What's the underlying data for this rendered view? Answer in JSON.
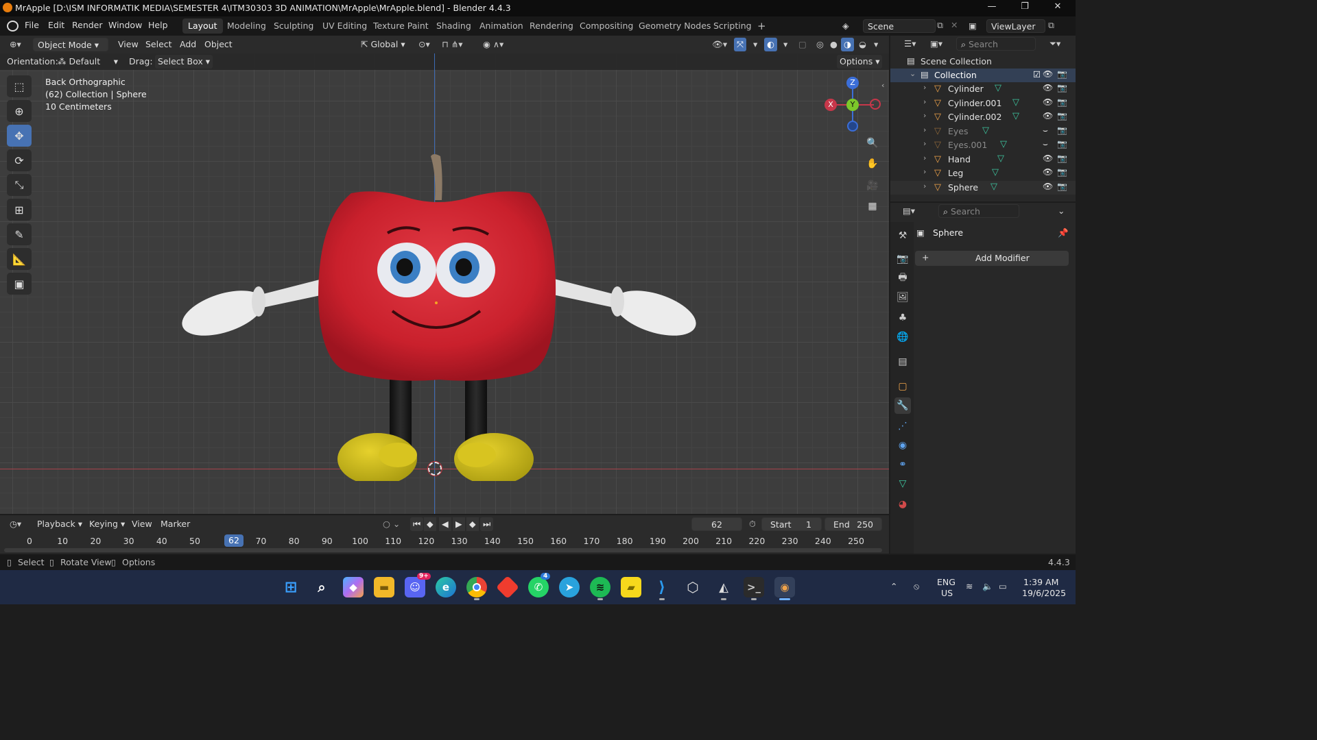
{
  "window": {
    "title": "MrApple [D:\\ISM INFORMATIK MEDIA\\SEMESTER 4\\ITM30303 3D ANIMATION\\MrApple\\MrApple.blend] - Blender 4.4.3",
    "minimize": "—",
    "maximize": "❐",
    "close": "✕"
  },
  "menu": {
    "file": "File",
    "edit": "Edit",
    "render": "Render",
    "window": "Window",
    "help": "Help"
  },
  "workspaces": [
    "Layout",
    "Modeling",
    "Sculpting",
    "UV Editing",
    "Texture Paint",
    "Shading",
    "Animation",
    "Rendering",
    "Compositing",
    "Geometry Nodes",
    "Scripting"
  ],
  "scene": {
    "name": "Scene",
    "view_layer": "ViewLayer"
  },
  "viewport_header": {
    "mode": "Object Mode",
    "view": "View",
    "select": "Select",
    "add": "Add",
    "object": "Object",
    "transform": "Global"
  },
  "tool_settings": {
    "orientation_label": "Orientation:",
    "orientation": "Default",
    "drag_label": "Drag:",
    "drag": "Select Box",
    "options": "Options"
  },
  "viewport_overlay": {
    "view_name": "Back Orthographic",
    "collection_info": "(62) Collection | Sphere",
    "scale": "10 Centimeters"
  },
  "gizmo": {
    "z": "Z",
    "y": "Y",
    "x": "X"
  },
  "outliner": {
    "search_placeholder": "Search",
    "root": "Scene Collection",
    "collection": "Collection",
    "items": [
      {
        "name": "Cylinder",
        "hidden": false
      },
      {
        "name": "Cylinder.001",
        "hidden": false
      },
      {
        "name": "Cylinder.002",
        "hidden": false
      },
      {
        "name": "Eyes",
        "hidden": true
      },
      {
        "name": "Eyes.001",
        "hidden": true
      },
      {
        "name": "Hand",
        "hidden": false
      },
      {
        "name": "Leg",
        "hidden": false
      },
      {
        "name": "Sphere",
        "hidden": false
      }
    ]
  },
  "properties": {
    "search_placeholder": "Search",
    "object_name": "Sphere",
    "add_modifier": "Add Modifier"
  },
  "timeline": {
    "playback": "Playback",
    "keying": "Keying",
    "view": "View",
    "marker": "Marker",
    "current_frame": "62",
    "start_label": "Start",
    "start": "1",
    "end_label": "End",
    "end": "250",
    "ticks": [
      "0",
      "10",
      "20",
      "30",
      "40",
      "50",
      "70",
      "80",
      "90",
      "100",
      "110",
      "120",
      "130",
      "140",
      "150",
      "160",
      "170",
      "180",
      "190",
      "200",
      "210",
      "220",
      "230",
      "240",
      "250"
    ],
    "playhead": "62"
  },
  "statusbar": {
    "select": "Select",
    "rotate": "Rotate View",
    "options": "Options",
    "version": "4.4.3"
  },
  "taskbar": {
    "lang": "ENG",
    "region": "US",
    "time": "1:39 AM",
    "date": "19/6/2025",
    "discord_badge": "9+",
    "whatsapp_badge": "4"
  }
}
